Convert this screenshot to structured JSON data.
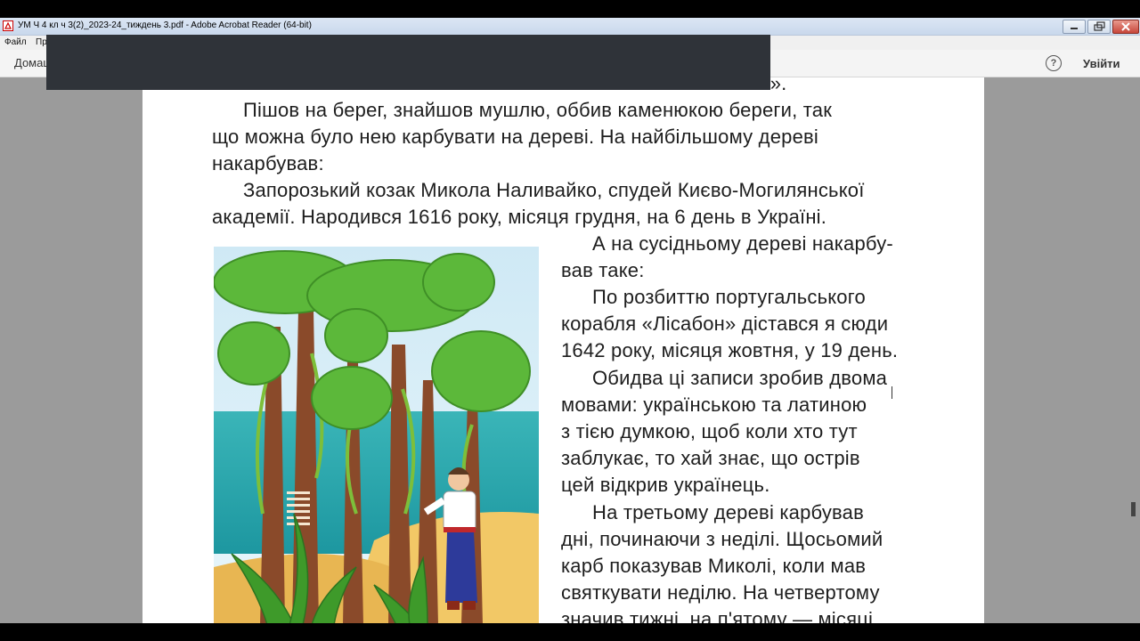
{
  "window": {
    "title": "УМ Ч 4 кл ч 3(2)_2023-24_тиждень 3.pdf - Adobe Acrobat Reader (64-bit)"
  },
  "menu": {
    "file": "Файл",
    "edit_partial": "Пр"
  },
  "toolbar": {
    "home_partial": "Домаш",
    "help": "?",
    "signin": "Увійти"
  },
  "document": {
    "lines": [
      "ати».",
      "Пішов на берег, знайшов мушлю, оббив каменюкою береги, так",
      "що можна було нею карбувати на дереві. На найбільшому дереві",
      "накарбував:",
      "Запорозький козак Микола Наливайко, спудей Києво-Могилянської",
      "академії. Народився 1616 року, місяця грудня, на 6 день в Україні.",
      "А на сусідньому дереві накарбу-",
      "вав таке:",
      "По розбиттю португальського",
      "корабля «Лісабон» дістався я сюди",
      "1642 року, місяця жовтня, у 19 день.",
      "Обидва ці записи зробив двома",
      "мовами: українською та латиною",
      "з тією думкою, щоб коли хто тут",
      "заблукає, то хай знає, що острів",
      "цей відкрив українець.",
      "На третьому дереві карбував",
      "дні, починаючи з неділі. Щосьомий",
      "карб показував Миколі, коли мав",
      "святкувати неділю. На четвертому",
      "значив тижні, на п'ятому — місяці,"
    ]
  },
  "icons": {
    "app": "acrobat-icon",
    "minimize": "minimize-icon",
    "maximize": "restore-icon",
    "close": "close-icon",
    "help": "help-icon"
  },
  "colors": {
    "page_bg": "#ffffff",
    "viewer_bg": "#9b9b9b",
    "text": "#1e1e1e"
  }
}
